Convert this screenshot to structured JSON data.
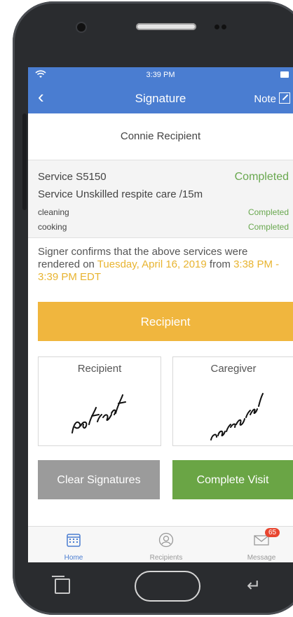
{
  "status_bar": {
    "time": "3:39 PM"
  },
  "nav": {
    "title": "Signature",
    "note_label": "Note"
  },
  "recipient_name": "Connie Recipient",
  "services": [
    {
      "label": "Service S5150",
      "status": "Completed"
    },
    {
      "label": "Service Unskilled respite care /15m",
      "status": ""
    },
    {
      "label": "cleaning",
      "status": "Completed"
    },
    {
      "label": "cooking",
      "status": "Completed"
    }
  ],
  "confirmation": {
    "prefix": "Signer confirms that the above services were rendered on ",
    "date": "Tuesday, April 16, 2019",
    "mid": " from ",
    "time_range": "3:38 PM - 3:39 PM EDT"
  },
  "recipient_button": "Recipient",
  "signatures": {
    "recipient_label": "Recipient",
    "caregiver_label": "Caregiver"
  },
  "actions": {
    "clear_label": "Clear Signatures",
    "complete_label": "Complete Visit"
  },
  "tabs": [
    {
      "label": "Home",
      "icon": "calendar-icon"
    },
    {
      "label": "Recipients",
      "icon": "person-icon"
    },
    {
      "label": "Message",
      "icon": "envelope-icon",
      "badge": "65"
    }
  ],
  "colors": {
    "nav_blue": "#4a7dd1",
    "completed_green": "#69a84f",
    "highlight_yellow": "#e8b430",
    "recipient_button": "#f0b63e",
    "complete_button": "#6aa545",
    "clear_button": "#9b9b9b",
    "badge_red": "#e8452f"
  }
}
